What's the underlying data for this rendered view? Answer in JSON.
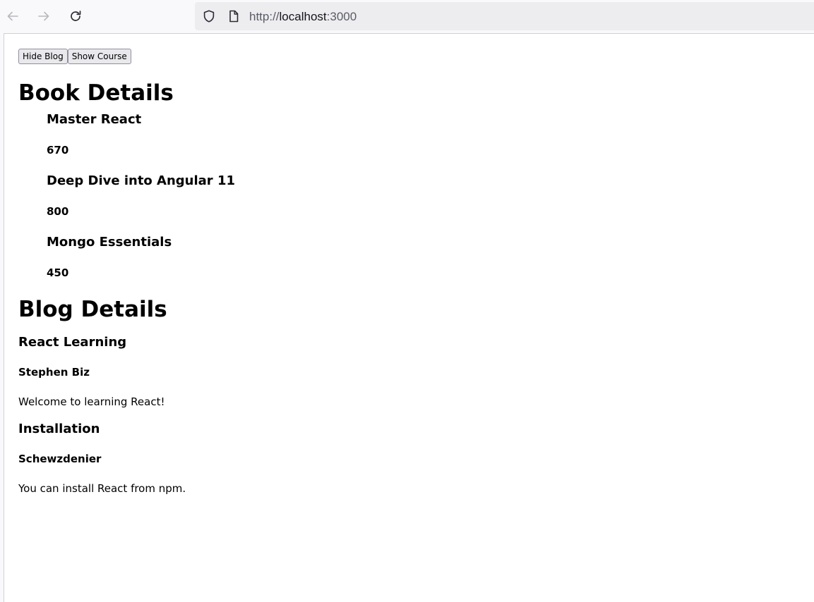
{
  "browser": {
    "url_scheme": "http://",
    "url_host": "localhost",
    "url_port": ":3000"
  },
  "controls": {
    "hide_blog_label": "Hide Blog",
    "show_course_label": "Show Course"
  },
  "book_section": {
    "heading": "Book Details",
    "books": [
      {
        "name": "Master React",
        "price": "670"
      },
      {
        "name": "Deep Dive into Angular 11",
        "price": "800"
      },
      {
        "name": "Mongo Essentials",
        "price": "450"
      }
    ]
  },
  "blog_section": {
    "heading": "Blog Details",
    "blogs": [
      {
        "title": "React Learning",
        "author": "Stephen Biz",
        "content": "Welcome to learning React!"
      },
      {
        "title": "Installation",
        "author": "Schewzdenier",
        "content": "You can install React from npm."
      }
    ]
  }
}
